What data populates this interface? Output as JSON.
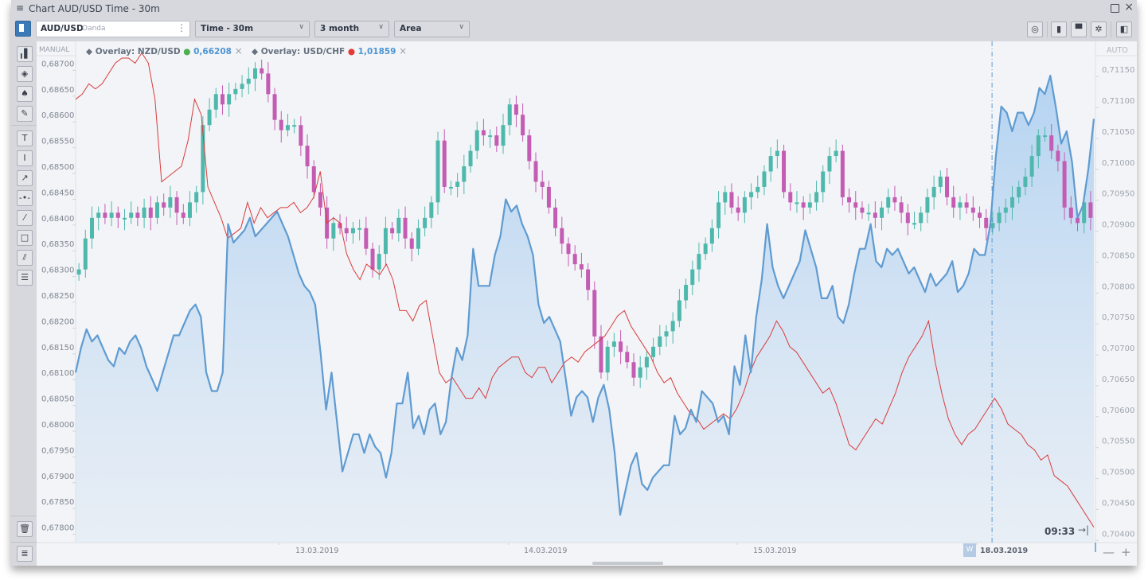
{
  "window": {
    "title": "Chart AUD/USD Time - 30m",
    "menu_icon": "hamburger-icon",
    "maximize_icon": "maximize-icon",
    "close_icon": "close-icon"
  },
  "toolbar": {
    "symbol": "AUD/USD",
    "source": "Oanda",
    "more_icon": "vertical-dots-icon",
    "timeframe": "Time - 30m",
    "period": "3 month",
    "chart_type": "Area",
    "right_icons": [
      "chart-search-icon",
      "mouse-icon",
      "template-icon",
      "gear-icon",
      "panel-toggle-icon"
    ]
  },
  "left_toolbar": {
    "icons": [
      "indicators-icon",
      "layers-icon",
      "alert-bell-icon",
      "pencil-icon",
      "text-icon",
      "vertical-line-icon",
      "arrow-icon",
      "horizontal-line-icon",
      "trend-line-icon",
      "rectangle-icon",
      "parallel-lines-icon",
      "object-list-icon"
    ],
    "trash_icon": "trash-icon",
    "list_icon": "list-icon"
  },
  "legend": {
    "overlay1_label": "Overlay: NZD/USD",
    "overlay1_value": "0,66208",
    "overlay1_dot": "#4caf50",
    "overlay2_label": "Overlay: USD/CHF",
    "overlay2_value": "1,01859",
    "overlay2_dot": "#e53935",
    "remove_symbol": "×"
  },
  "axes": {
    "left_mode": "MANUAL",
    "right_mode": "AUTO",
    "current_time": "09:33",
    "go_end_symbol": "→|",
    "week_badge": "W",
    "zoom_out": "—",
    "zoom_in": "+"
  },
  "chart_data": {
    "type": "area",
    "title": "Chart AUD/USD Time - 30m",
    "left_axis": {
      "mode": "MANUAL",
      "ylim": [
        0.6777,
        0.6873
      ],
      "ticks": [
        "0,68700",
        "0,68650",
        "0,68600",
        "0,68550",
        "0,68500",
        "0,68450",
        "0,68400",
        "0,68350",
        "0,68300",
        "0,68250",
        "0,68200",
        "0,68150",
        "0,68100",
        "0,68050",
        "0,68000",
        "0,67950",
        "0,67900",
        "0,67850",
        "0,67800"
      ]
    },
    "right_axis": {
      "mode": "AUTO",
      "ylim": [
        0.70385,
        0.71185
      ],
      "ticks": [
        "0,71150",
        "0,71100",
        "0,71050",
        "0,71000",
        "0,70950",
        "0,70900",
        "0,70850",
        "0,70800",
        "0,70750",
        "0,70700",
        "0,70650",
        "0,70600",
        "0,70550",
        "0,70500",
        "0,70450",
        "0,70400"
      ]
    },
    "x_ticks": [
      "13.03.2019",
      "14.03.2019",
      "15.03.2019",
      "18.03.2019"
    ],
    "x_tick_positions": [
      0.2,
      0.425,
      0.65,
      0.885
    ],
    "crosshair_x": 0.9,
    "series": [
      {
        "name": "AUD/USD",
        "type": "area",
        "axis": "right",
        "color": "#5f9bd1",
        "values": [
          0.7066,
          0.707,
          0.7073,
          0.7071,
          0.7072,
          0.707,
          0.7068,
          0.7067,
          0.707,
          0.7069,
          0.7071,
          0.7072,
          0.707,
          0.7067,
          0.7065,
          0.7063,
          0.7066,
          0.7069,
          0.7072,
          0.7072,
          0.7074,
          0.7076,
          0.7077,
          0.7075,
          0.7066,
          0.7063,
          0.7063,
          0.7066,
          0.709,
          0.7087,
          0.7088,
          0.7089,
          0.7091,
          0.7088,
          0.7089,
          0.709,
          0.7091,
          0.7092,
          0.709,
          0.7088,
          0.7085,
          0.7082,
          0.708,
          0.7079,
          0.7077,
          0.7069,
          0.706,
          0.7066,
          0.7058,
          0.705,
          0.7053,
          0.7056,
          0.7056,
          0.7053,
          0.7056,
          0.7054,
          0.7053,
          0.7049,
          0.7053,
          0.7061,
          0.7061,
          0.7066,
          0.7057,
          0.7059,
          0.7056,
          0.706,
          0.7061,
          0.7056,
          0.7058,
          0.7065,
          0.707,
          0.7068,
          0.7072,
          0.7086,
          0.708,
          0.708,
          0.708,
          0.7085,
          0.7088,
          0.7094,
          0.7092,
          0.7093,
          0.709,
          0.7088,
          0.7085,
          0.7077,
          0.7074,
          0.7075,
          0.7073,
          0.7071,
          0.7065,
          0.7059,
          0.7062,
          0.7063,
          0.7062,
          0.7058,
          0.7062,
          0.7064,
          0.706,
          0.7053,
          0.7043,
          0.7047,
          0.7051,
          0.7053,
          0.7048,
          0.7047,
          0.7049,
          0.705,
          0.7051,
          0.7051,
          0.7059,
          0.7056,
          0.7057,
          0.706,
          0.7058,
          0.7063,
          0.7062,
          0.7061,
          0.7058,
          0.7059,
          0.7056,
          0.7067,
          0.7064,
          0.7072,
          0.7066,
          0.7075,
          0.7081,
          0.709,
          0.7083,
          0.708,
          0.7078,
          0.708,
          0.7082,
          0.7084,
          0.7089,
          0.7086,
          0.7083,
          0.7078,
          0.7078,
          0.708,
          0.7075,
          0.7074,
          0.7077,
          0.7082,
          0.7086,
          0.7086,
          0.709,
          0.7084,
          0.7083,
          0.7086,
          0.7085,
          0.7086,
          0.7084,
          0.7082,
          0.7083,
          0.7081,
          0.7079,
          0.7082,
          0.708,
          0.7081,
          0.7082,
          0.7084,
          0.7079,
          0.708,
          0.7082,
          0.7086,
          0.7085,
          0.7085,
          0.709,
          0.7101,
          0.7109,
          0.7108,
          0.7105,
          0.7108,
          0.7108,
          0.7106,
          0.7108,
          0.7112,
          0.7111,
          0.7114,
          0.7109,
          0.7103,
          0.7105,
          0.71,
          0.7091,
          0.7093,
          0.7099,
          0.7107
        ],
        "last": "0,71070"
      },
      {
        "name": "NZD/USD",
        "type": "candlestick",
        "axis": "left",
        "color_up": "#4fb8ac",
        "color_down": "#c45cb3",
        "closes": [
          0.683,
          0.6836,
          0.684,
          0.6841,
          0.684,
          0.6841,
          0.684,
          0.684,
          0.6841,
          0.684,
          0.6842,
          0.684,
          0.6843,
          0.6842,
          0.6844,
          0.6841,
          0.684,
          0.6843,
          0.6845,
          0.6858,
          0.6861,
          0.6864,
          0.6862,
          0.6864,
          0.6865,
          0.6866,
          0.6867,
          0.6869,
          0.6868,
          0.6864,
          0.6859,
          0.6857,
          0.6858,
          0.6858,
          0.6854,
          0.685,
          0.6845,
          0.6842,
          0.6836,
          0.6839,
          0.6838,
          0.6837,
          0.6838,
          0.6838,
          0.6834,
          0.683,
          0.6833,
          0.6838,
          0.6837,
          0.684,
          0.6836,
          0.6834,
          0.6838,
          0.684,
          0.6843,
          0.6855,
          0.6846,
          0.6846,
          0.6847,
          0.685,
          0.6853,
          0.6857,
          0.6856,
          0.6856,
          0.6854,
          0.6858,
          0.6862,
          0.686,
          0.6856,
          0.6851,
          0.6847,
          0.6846,
          0.6842,
          0.6838,
          0.6835,
          0.6833,
          0.6831,
          0.683,
          0.6826,
          0.6817,
          0.681,
          0.6815,
          0.6816,
          0.6814,
          0.6812,
          0.6809,
          0.6811,
          0.6813,
          0.6815,
          0.6817,
          0.6818,
          0.682,
          0.6824,
          0.6827,
          0.683,
          0.6833,
          0.6835,
          0.6838,
          0.6843,
          0.6845,
          0.6842,
          0.6841,
          0.6844,
          0.6845,
          0.6846,
          0.6849,
          0.6852,
          0.6853,
          0.6845,
          0.6843,
          0.6843,
          0.6842,
          0.6843,
          0.6845,
          0.6849,
          0.6852,
          0.6853,
          0.6844,
          0.6843,
          0.6842,
          0.6841,
          0.6841,
          0.684,
          0.6842,
          0.6844,
          0.6843,
          0.6841,
          0.6839,
          0.6839,
          0.6841,
          0.6844,
          0.6846,
          0.6848,
          0.6844,
          0.6842,
          0.6843,
          0.6842,
          0.6841,
          0.684,
          0.6838,
          0.6839,
          0.6841,
          0.6842,
          0.6844,
          0.6846,
          0.6848,
          0.6852,
          0.6856,
          0.6856,
          0.6853,
          0.6851,
          0.6842,
          0.684,
          0.6839,
          0.6843,
          0.684
        ]
      },
      {
        "name": "USD/CHF",
        "type": "line",
        "axis": "left",
        "color": "#d93b3b",
        "values": [
          0.6863,
          0.6864,
          0.6866,
          0.6865,
          0.6866,
          0.6868,
          0.687,
          0.6871,
          0.6871,
          0.687,
          0.6872,
          0.687,
          0.6863,
          0.6847,
          0.6848,
          0.6849,
          0.685,
          0.6855,
          0.6863,
          0.686,
          0.6846,
          0.6843,
          0.684,
          0.6836,
          0.6837,
          0.6838,
          0.6843,
          0.6839,
          0.6842,
          0.684,
          0.6841,
          0.6842,
          0.6842,
          0.6843,
          0.6841,
          0.6842,
          0.6844,
          0.6849,
          0.6839,
          0.684,
          0.6839,
          0.6833,
          0.683,
          0.6828,
          0.6831,
          0.683,
          0.6829,
          0.6831,
          0.6828,
          0.6822,
          0.6822,
          0.682,
          0.6823,
          0.6824,
          0.6817,
          0.681,
          0.6808,
          0.6809,
          0.6807,
          0.6805,
          0.6805,
          0.6807,
          0.6805,
          0.6809,
          0.6811,
          0.6812,
          0.6813,
          0.6813,
          0.681,
          0.6809,
          0.6811,
          0.6811,
          0.6808,
          0.681,
          0.6812,
          0.6813,
          0.6812,
          0.6814,
          0.6815,
          0.6816,
          0.6817,
          0.6819,
          0.6821,
          0.6822,
          0.6819,
          0.6817,
          0.6815,
          0.6813,
          0.681,
          0.6808,
          0.6809,
          0.6806,
          0.6804,
          0.6802,
          0.6801,
          0.6799,
          0.68,
          0.6801,
          0.6802,
          0.6801,
          0.6803,
          0.6806,
          0.681,
          0.6813,
          0.6815,
          0.6817,
          0.682,
          0.6818,
          0.6815,
          0.6814,
          0.6812,
          0.681,
          0.6808,
          0.6806,
          0.6807,
          0.6804,
          0.68,
          0.6796,
          0.6795,
          0.6797,
          0.6799,
          0.6801,
          0.68,
          0.6803,
          0.6806,
          0.681,
          0.6813,
          0.6815,
          0.6817,
          0.682,
          0.6812,
          0.6806,
          0.6801,
          0.6798,
          0.6796,
          0.6798,
          0.6799,
          0.6801,
          0.6803,
          0.6805,
          0.6803,
          0.68,
          0.6799,
          0.6798,
          0.6796,
          0.6795,
          0.6793,
          0.6794,
          0.679,
          0.6789,
          0.6788,
          0.6786,
          0.6784,
          0.6782,
          0.678
        ]
      }
    ]
  }
}
